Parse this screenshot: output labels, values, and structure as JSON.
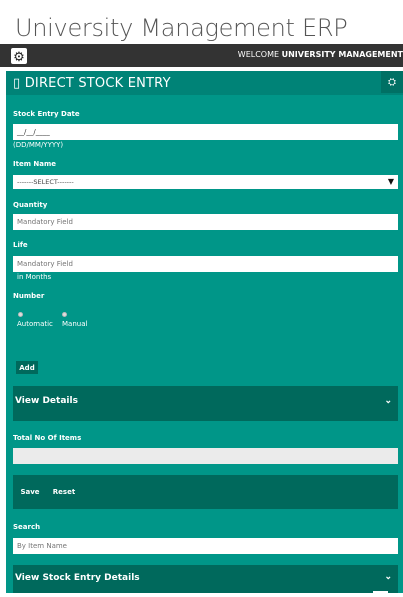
{
  "app": {
    "title": "University Management ERP",
    "welcome_prefix": "WELCOME ",
    "welcome_user": "UNIVERSITY MANAGEMENT"
  },
  "icons": {
    "settings": "gear-icon",
    "panel_toggle": "collapse-icon",
    "chevron": "chevron-down-icon"
  },
  "colors": {
    "panel": "#009688",
    "panel_header": "#008377",
    "section_bar": "#00695c",
    "topbar": "#333333"
  },
  "panel": {
    "title_icon": "▯",
    "title": "DIRECT STOCK ENTRY"
  },
  "form": {
    "stock_entry_date": {
      "label": "Stock Entry Date",
      "value": "__/__/____",
      "hint": "(DD/MM/YYYY)"
    },
    "item_name": {
      "label": "Item Name",
      "selected": "-------SELECT-------"
    },
    "quantity": {
      "label": "Quantity",
      "placeholder": "Mandatory Field"
    },
    "life": {
      "label": "Life",
      "placeholder": "Mandatory Field",
      "hint": "in Months"
    },
    "number": {
      "label": "Number",
      "options": [
        "Automatic",
        "Manual"
      ]
    },
    "add_label": "Add"
  },
  "view_details": {
    "title": "View Details"
  },
  "total": {
    "label": "Total No Of Items",
    "value": ""
  },
  "actions": {
    "save_label": "Save",
    "reset_label": "Reset"
  },
  "search": {
    "label": "Search",
    "placeholder": "By Item Name"
  },
  "view_stock": {
    "title": "View Stock Entry Details"
  }
}
